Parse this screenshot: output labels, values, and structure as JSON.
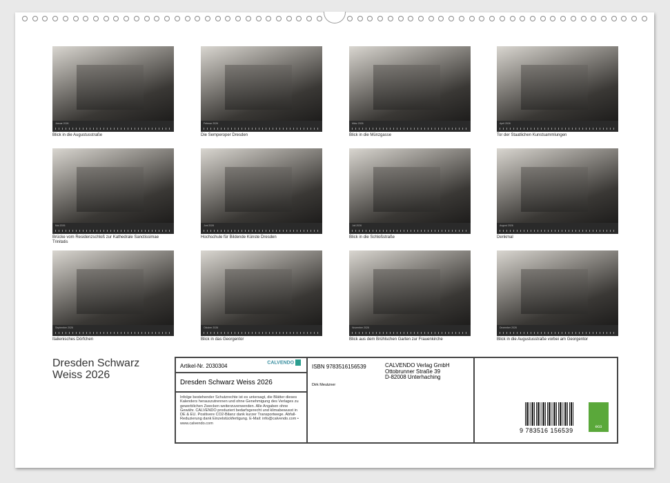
{
  "months": [
    {
      "label": "Januar 2026",
      "caption": "Blick in die Augustusstraße"
    },
    {
      "label": "Februar 2026",
      "caption": "Die Semperoper Dresden"
    },
    {
      "label": "März 2026",
      "caption": "Blick in die Münzgasse"
    },
    {
      "label": "April 2026",
      "caption": "Tor der Staatlichen Kunstsammlungen"
    },
    {
      "label": "Mai 2026",
      "caption": "Brücke vom Residenzschloß zur Kathedrale Sanctissimae Trinitatis"
    },
    {
      "label": "Juni 2026",
      "caption": "Hochschule für Bildende Künste Dresden"
    },
    {
      "label": "Juli 2026",
      "caption": "Blick in die Schloßstraße"
    },
    {
      "label": "August 2026",
      "caption": "Denkmal"
    },
    {
      "label": "September 2026",
      "caption": "Italienisches Dörfchen"
    },
    {
      "label": "Oktober 2026",
      "caption": "Blick in das Georgentor"
    },
    {
      "label": "November 2026",
      "caption": "Blick aus dem Brühlschen Garten zur Frauenkirche"
    },
    {
      "label": "Dezember 2026",
      "caption": "Blick in die Augustusstraße vorbei am Georgentor"
    }
  ],
  "title": "Dresden Schwarz Weiss 2026",
  "info": {
    "artikel": "Artikel-Nr. 2030304",
    "logo": "CALVENDO",
    "name": "Dresden Schwarz Weiss 2026",
    "legal": "Infolge bestehender Schutzrechte ist es untersagt, die Blätter dieses Kalenders herauszutrennen und ohne Genehmigung des Verlages zu gewerblichen Zwecken weiterzuverwenden. Alle Angaben ohne Gewähr. CALVENDO produziert bedarfsgerecht und klimabewusst in DE & EU. Positivere CO2-Bilanz dank kurzer Transportwege. Abfall-Reduzierung dank Einzelstückfertigung. E-Mail: info@calvendo.com • www.calvendo.com",
    "isbn": "ISBN 9783516156539",
    "author": "Dirk Meutzner",
    "publisher": [
      "CALVENDO Verlag GmbH",
      "Ottobrunner Straße 39",
      "D-82008 Unterhaching"
    ],
    "barcode": "9 783516 156539",
    "eco": "eco"
  }
}
